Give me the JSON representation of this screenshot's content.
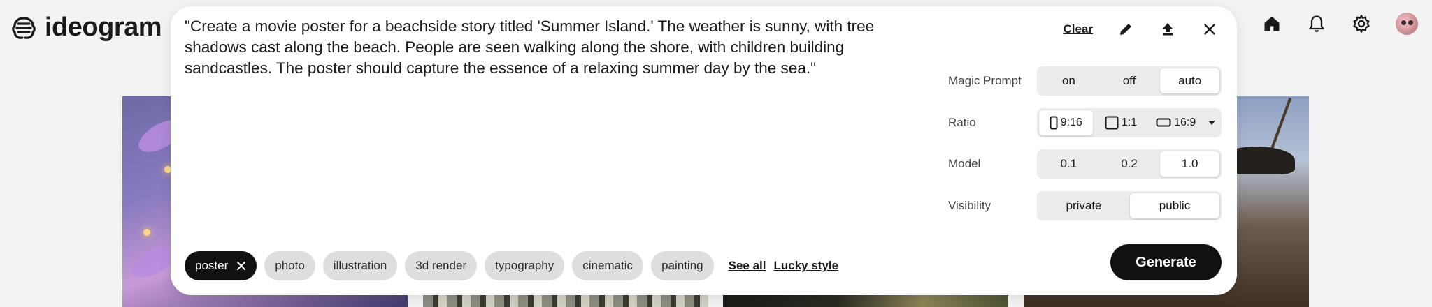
{
  "app": {
    "logo_text": "ideogram"
  },
  "header": {
    "icons": [
      "home-icon",
      "bell-icon",
      "gear-icon",
      "avatar"
    ]
  },
  "prompt": {
    "text": "\"Create a movie poster for a beachside story titled 'Summer Island.' The weather is sunny, with tree shadows cast along the beach. People are seen walking along the shore, with children building sandcastles. The poster should capture the essence of a relaxing summer day by the sea.\""
  },
  "card_actions": {
    "clear_label": "Clear",
    "icons": [
      "pencil-icon",
      "upload-icon",
      "close-icon"
    ]
  },
  "settings": {
    "magic_prompt": {
      "label": "Magic Prompt",
      "options": [
        "on",
        "off",
        "auto"
      ],
      "selected": "auto"
    },
    "ratio": {
      "label": "Ratio",
      "options": [
        "9:16",
        "1:1",
        "16:9"
      ],
      "selected": "9:16"
    },
    "model": {
      "label": "Model",
      "options": [
        "0.1",
        "0.2",
        "1.0"
      ],
      "selected": "1.0"
    },
    "visibility": {
      "label": "Visibility",
      "options": [
        "private",
        "public"
      ],
      "selected": "public"
    }
  },
  "tags": {
    "items": [
      "poster",
      "photo",
      "illustration",
      "3d render",
      "typography",
      "cinematic",
      "painting"
    ],
    "active": "poster",
    "see_all": "See all",
    "lucky": "Lucky style"
  },
  "generate_label": "Generate",
  "colors": {
    "accent": "#111111",
    "background": "#f3f3f3",
    "card": "#ffffff",
    "chip": "#dedede"
  }
}
